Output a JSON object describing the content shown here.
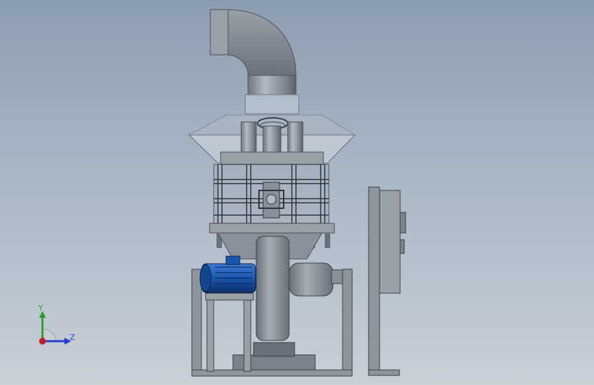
{
  "viewport": {
    "background_top": "#8d9db0",
    "background_bottom": "#c8d0d8"
  },
  "model": {
    "parts": [
      "exhaust-elbow-duct",
      "cyclone-hopper-cone",
      "cage-frame-housing",
      "inspection-flange",
      "spring-mounts",
      "centrifugal-fan-housing",
      "blue-electric-motor",
      "motor-base-frame",
      "support-leg-frame",
      "side-control-cabinet"
    ],
    "colors": {
      "steel": "#8a9099",
      "steel_dark": "#4a4f57",
      "motor_blue": "#1a57b0",
      "glass": "#b8c3cf"
    }
  },
  "triad": {
    "y_label": "Y",
    "z_label": "Z",
    "y_color": "#2aa02a",
    "z_color": "#2a3ccf",
    "x_color": "#c0202a"
  }
}
